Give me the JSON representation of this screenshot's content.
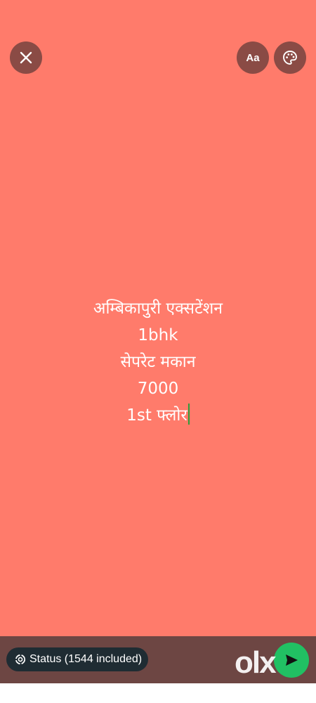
{
  "app": {
    "name": "WhatsApp status composer"
  },
  "colors": {
    "background": "#ff7b6b",
    "control_bg": "#8a4b45",
    "bottom_bar": "#6d4643",
    "chip_bg": "#1f2c33",
    "send_green": "#21c063",
    "caret": "#2e9d3a"
  },
  "top_bar": {
    "close_icon": "close-icon",
    "font_button_label": "Aa",
    "palette_icon": "palette-icon"
  },
  "status_text": {
    "lines": [
      "अम्बिकापुरी एक्सटेंशन",
      "1bhk",
      "सेपरेट मकान",
      "7000",
      "1st फ्लोर"
    ]
  },
  "bottom": {
    "audience_label": "Status (1544 included)",
    "audience_icon": "status-ring-icon",
    "send_icon": "send-icon",
    "watermark": "olx"
  }
}
